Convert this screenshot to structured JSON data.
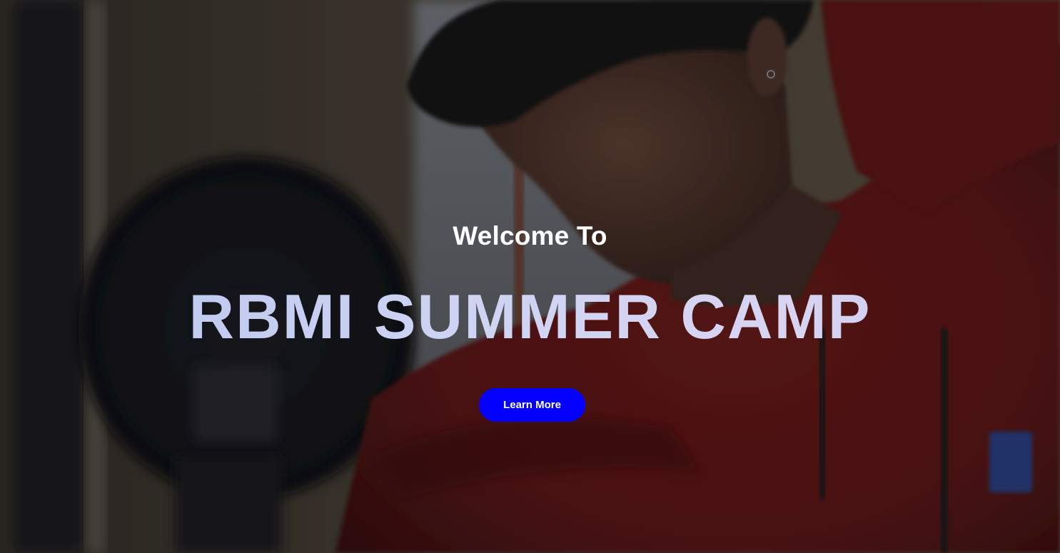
{
  "hero": {
    "welcome_text": "Welcome To",
    "title": "RBMI SUMMER CAMP",
    "cta_label": "Learn More"
  },
  "colors": {
    "cta_background": "#0400ff",
    "title_gradient": [
      "#b8c4ee",
      "#cfd4f3",
      "#d8d4f2",
      "#c8c6ee"
    ],
    "welcome_text": "#ffffff"
  },
  "background": {
    "subject": "student in red hoodie at gym machine"
  }
}
